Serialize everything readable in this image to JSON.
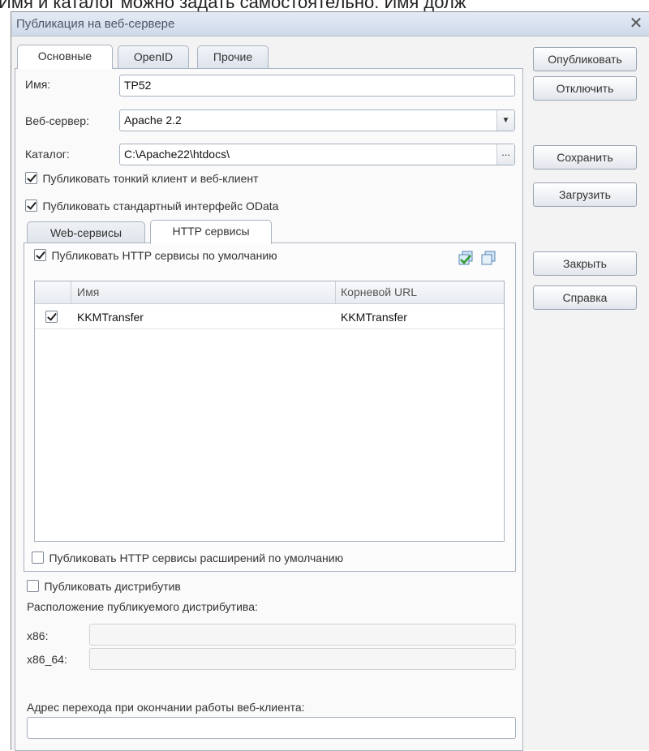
{
  "top_strip_text": "Имя и каталог можно задать самостоятельно. Имя долж",
  "window": {
    "title": "Публикация на веб-сервере",
    "close_glyph": "✕"
  },
  "tabs": [
    {
      "label": "Основные",
      "active": true
    },
    {
      "label": "OpenID",
      "active": false
    },
    {
      "label": "Прочие",
      "active": false
    }
  ],
  "form": {
    "name_label": "Имя:",
    "name_value": "TP52",
    "server_label": "Веб-сервер:",
    "server_value": "Apache 2.2",
    "catalog_label": "Каталог:",
    "catalog_value": "C:\\Apache22\\htdocs\\",
    "catalog_button": "...",
    "dropdown_glyph": "▼"
  },
  "checkboxes": {
    "thin_client": {
      "label": "Публиковать тонкий клиент и веб-клиент",
      "checked": true
    },
    "odata": {
      "label": "Публиковать стандартный интерфейс OData",
      "checked": true
    },
    "http_default": {
      "label": "Публиковать HTTP сервисы по умолчанию",
      "checked": true
    },
    "http_ext": {
      "label": "Публиковать HTTP сервисы расширений по умолчанию",
      "checked": false
    },
    "distrib": {
      "label": "Публиковать дистрибутив",
      "checked": false
    }
  },
  "inner_tabs": [
    {
      "label": "Web-сервисы",
      "active": false
    },
    {
      "label": "HTTP сервисы",
      "active": true
    }
  ],
  "table": {
    "columns": [
      "Имя",
      "Корневой URL"
    ],
    "rows": [
      {
        "checked": true,
        "name": "KKMTransfer",
        "url": "KKMTransfer"
      }
    ]
  },
  "distrib": {
    "location_label": "Расположение публикуемого дистрибутива:",
    "x86_label": "x86:",
    "x86_64_label": "x86_64:",
    "x86_value": "",
    "x86_64_value": ""
  },
  "redirect": {
    "label": "Адрес перехода при окончании работы веб-клиента:",
    "value": ""
  },
  "buttons": {
    "publish": "Опубликовать",
    "disable": "Отключить",
    "save": "Сохранить",
    "load": "Загрузить",
    "close": "Закрыть",
    "help": "Справка"
  },
  "icons": [
    "check-all-icon",
    "uncheck-all-icon"
  ]
}
